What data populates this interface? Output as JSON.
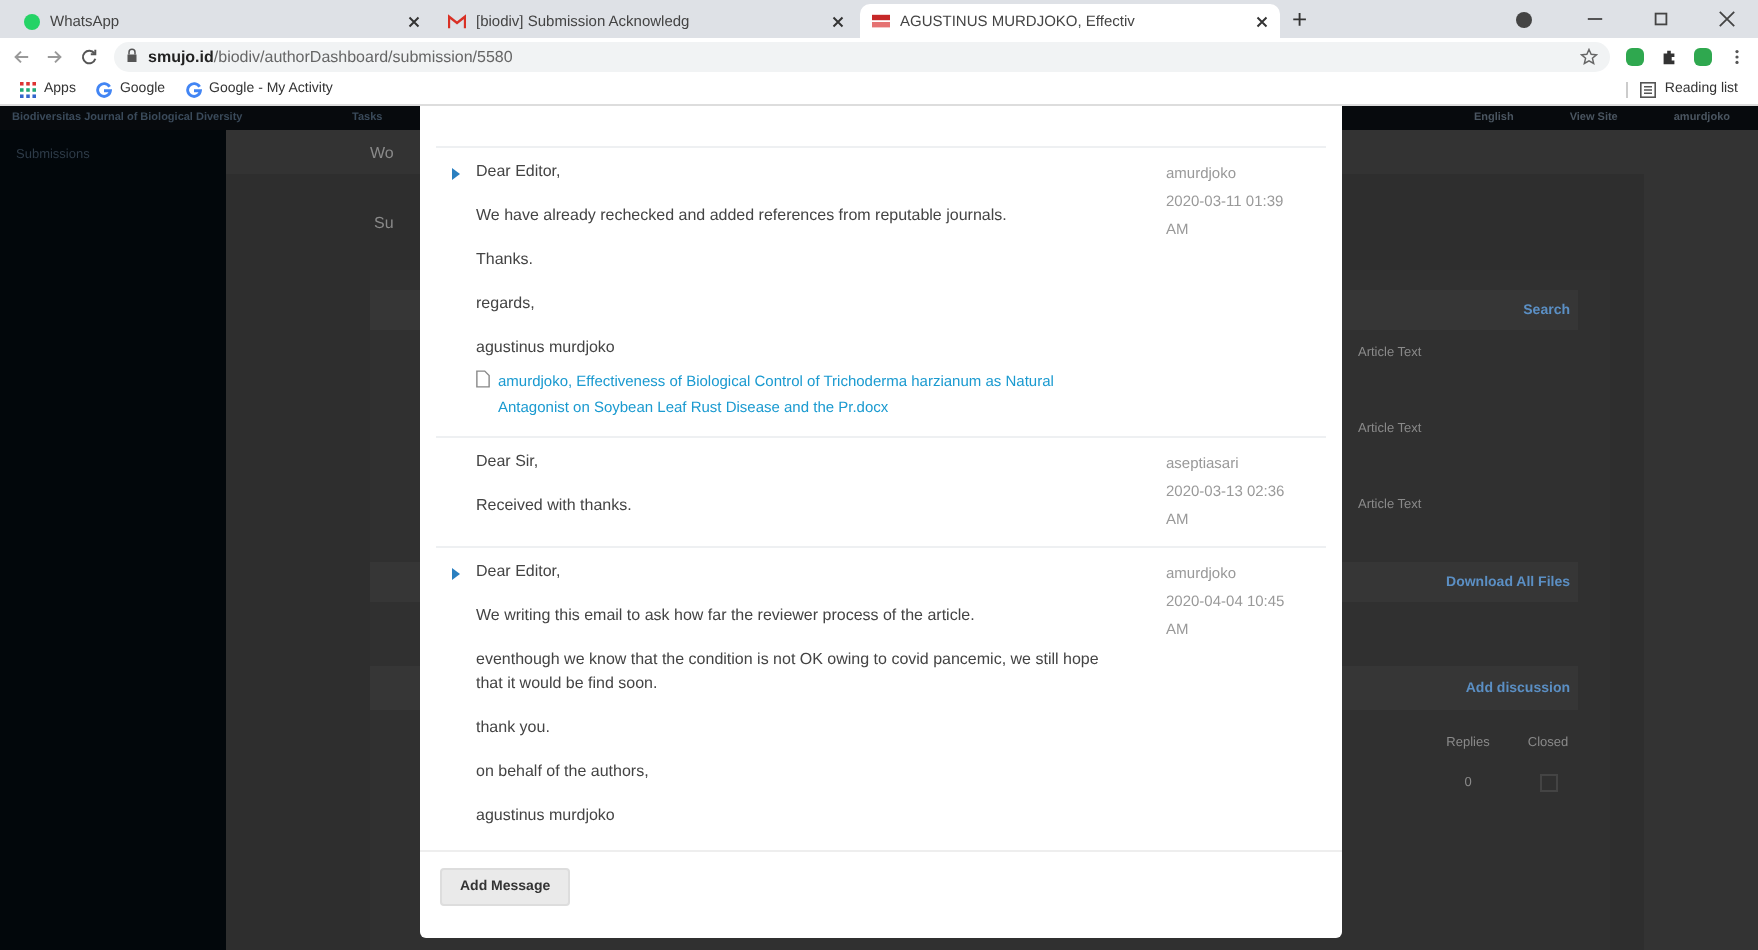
{
  "browser": {
    "tabs": [
      {
        "kind": "whatsapp",
        "title": "WhatsApp",
        "selected": false
      },
      {
        "kind": "gmail",
        "title": "[biodiv] Submission Acknowledg",
        "selected": false
      },
      {
        "kind": "journal",
        "title": "AGUSTINUS MURDJOKO, Effectiv",
        "selected": true
      }
    ],
    "new_tab": "+",
    "url_host": "smujo.id",
    "url_path": "/biodiv/authorDashboard/submission/5580",
    "bookmarks": [
      {
        "kind": "apps",
        "label": "Apps"
      },
      {
        "kind": "google",
        "label": "Google"
      },
      {
        "kind": "google",
        "label": "Google - My Activity"
      }
    ],
    "reading_list": "Reading list"
  },
  "header": {
    "site": "Biodiversitas Journal of Biological Diversity",
    "tasks": "Tasks",
    "language": "English",
    "view_site": "View Site",
    "user": "amurdjoko"
  },
  "sidebar": {
    "items": [
      "Submissions"
    ]
  },
  "backdrop": {
    "tab_fragment": "Wo",
    "subtab_fragment": "Su",
    "search": "Search",
    "files": [
      "Article Text",
      "Article Text",
      "Article Text"
    ],
    "download_all": "Download All Files",
    "add_discussion": "Add discussion",
    "columns": [
      "Replies",
      "Closed"
    ],
    "rows": [
      {
        "replies": "0",
        "closed": false
      }
    ]
  },
  "modal": {
    "notes": [
      {
        "toggle": true,
        "paragraphs": [
          "Dear Editor,",
          "We have already rechecked and added references from reputable journals.",
          "Thanks.",
          "regards,",
          "agustinus murdjoko"
        ],
        "attachment": "amurdjoko, Effectiveness of Biological Control of Trichoderma harzianum as Natural Antagonist on Soybean Leaf Rust Disease and the Pr.docx",
        "author": "amurdjoko",
        "date": "2020-03-11 01:39 AM"
      },
      {
        "toggle": false,
        "paragraphs": [
          "Dear Sir,",
          "Received with thanks."
        ],
        "author": "aseptiasari",
        "date": "2020-03-13 02:36 AM"
      },
      {
        "toggle": true,
        "paragraphs": [
          "Dear Editor,",
          "We writing this email to ask how far the reviewer process of the article.",
          "eventhough we know that the condition is not OK owing to covid pancemic, we still hope that it would be find soon.",
          "thank you.",
          "on behalf of the authors,",
          "agustinus murdjoko"
        ],
        "author": "amurdjoko",
        "date": "2020-04-04 10:45 AM"
      }
    ],
    "add_button": "Add Message"
  }
}
